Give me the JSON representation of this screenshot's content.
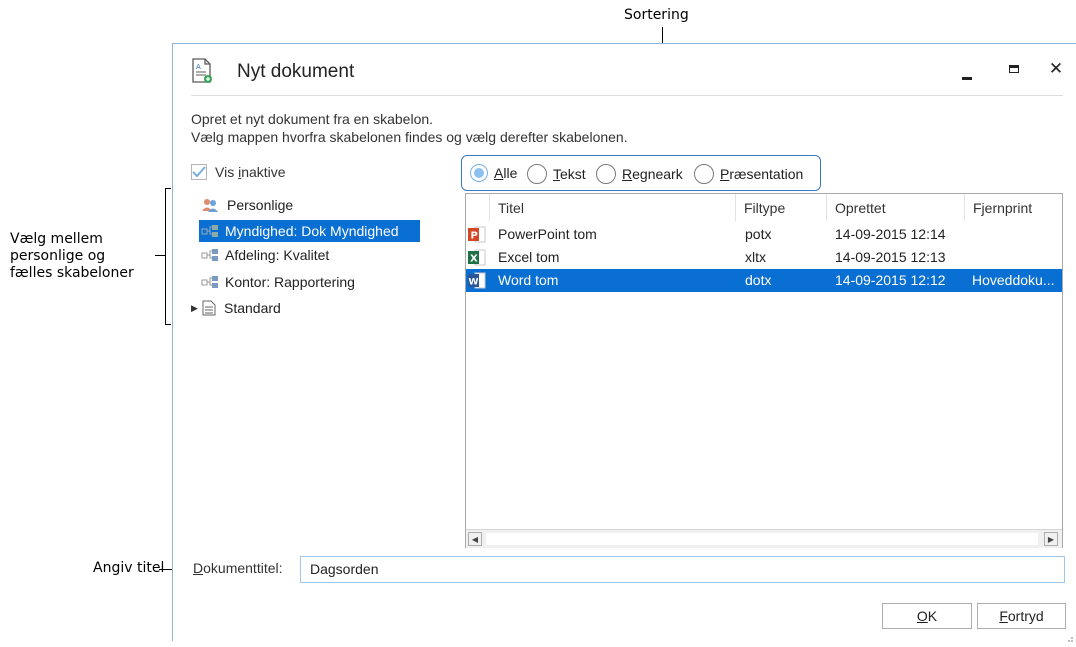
{
  "callouts": {
    "sortering": "Sortering",
    "vaelg_line1": "Vælg mellem",
    "vaelg_line2": "personlige og",
    "vaelg_line3": "fælles skabeloner",
    "angiv": "Angiv titel"
  },
  "dialog": {
    "title": "Nyt dokument",
    "desc_line1": "Opret et nyt dokument fra en skabelon.",
    "desc_line2": "Vælg mappen hvorfra skabelonen findes og vælg derefter skabelonen.",
    "show_inactive": {
      "pre": "Vis ",
      "ul": "i",
      "post": "naktive",
      "checked": true
    },
    "tree": [
      {
        "label": "Personlige",
        "icon": "person-group-icon"
      },
      {
        "label": "Myndighed: Dok Myndighed",
        "icon": "shared-folder-icon",
        "selected": true
      },
      {
        "label": "Afdeling: Kvalitet",
        "icon": "shared-folder-icon"
      },
      {
        "label": "Kontor: Rapportering",
        "icon": "shared-folder-icon"
      },
      {
        "label": "Standard",
        "icon": "document-icon",
        "expandable": true
      }
    ],
    "filters": {
      "alle": {
        "ul": "A",
        "rest": "lle",
        "checked": true
      },
      "tekst": {
        "ul": "T",
        "rest": "ekst"
      },
      "regneark": {
        "ul": "R",
        "rest": "egneark"
      },
      "praesentation": {
        "ul": "P",
        "rest": "ræsentation"
      }
    },
    "columns": [
      "Titel",
      "Filtype",
      "Oprettet",
      "Fjernprint"
    ],
    "rows": [
      {
        "icon": "powerpoint-icon",
        "title": "PowerPoint tom",
        "type": "potx",
        "created": "14-09-2015 12:14",
        "print": ""
      },
      {
        "icon": "excel-icon",
        "title": "Excel tom",
        "type": "xltx",
        "created": "14-09-2015 12:13",
        "print": ""
      },
      {
        "icon": "word-icon",
        "title": "Word tom",
        "type": "dotx",
        "created": "14-09-2015 12:12",
        "print": "Hoveddoku...",
        "selected": true
      }
    ],
    "title_field": {
      "label_ul": "D",
      "label_rest": "okumenttitel:",
      "value": "Dagsorden"
    },
    "ok": {
      "ul": "O",
      "rest": "K"
    },
    "cancel": {
      "ul": "F",
      "rest": "ortryd"
    }
  },
  "colors": {
    "accent": "#0a6fd2",
    "callout_box": "#3c78c4"
  }
}
